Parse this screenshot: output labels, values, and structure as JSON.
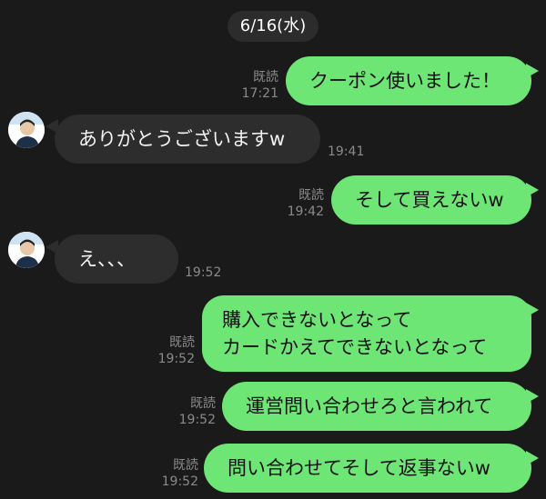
{
  "date_label": "6/16(水)",
  "messages": [
    {
      "dir": "out",
      "text": "クーポン使いました！",
      "read": "既読",
      "time": "17:21"
    },
    {
      "dir": "in",
      "text": "ありがとうございますw",
      "time": "19:41"
    },
    {
      "dir": "out",
      "text": "そして買えないw",
      "read": "既読",
      "time": "19:42"
    },
    {
      "dir": "in",
      "text": "え、、、",
      "time": "19:52"
    },
    {
      "dir": "out",
      "text": "購入できないとなって\nカードかえてできないとなって",
      "read": "既読",
      "time": "19:52"
    },
    {
      "dir": "out",
      "text": "運営問い合わせろと言われて",
      "read": "既読",
      "time": "19:52"
    },
    {
      "dir": "out",
      "text": "問い合わせてそして返事ないw",
      "read": "既読",
      "time": "19:52"
    }
  ],
  "colors": {
    "background": "#1a1a1a",
    "outgoing_bubble": "#6ee676",
    "incoming_bubble": "#2d2d2d",
    "date_pill": "#2c2c2c",
    "meta_text": "#8a8a8a"
  }
}
